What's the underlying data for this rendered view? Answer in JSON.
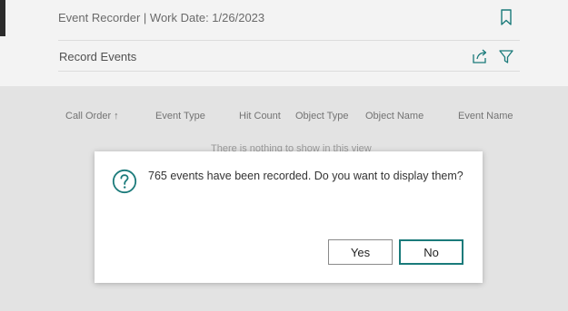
{
  "header": {
    "title": "Event Recorder | Work Date: 1/26/2023",
    "subpage_title": "Record Events"
  },
  "list": {
    "columns": [
      "Call Order ↑",
      "Event Type",
      "Hit Count",
      "Object Type",
      "Object Name",
      "Event Name"
    ],
    "empty_text": "There is nothing to show in this view"
  },
  "dialog": {
    "message": "765 events have been recorded. Do you want to display them?",
    "yes_label": "Yes",
    "no_label": "No"
  },
  "colors": {
    "accent": "#1a7a7a",
    "overlay": "#e3e3e3"
  }
}
